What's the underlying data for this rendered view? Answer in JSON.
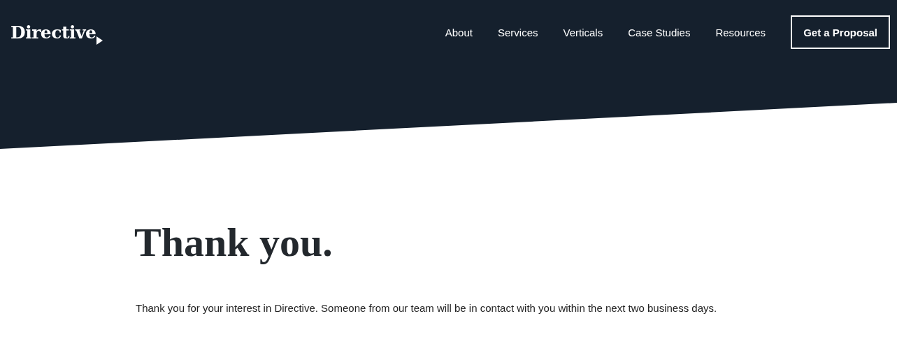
{
  "header": {
    "logo": "Directive",
    "nav": [
      {
        "label": "About"
      },
      {
        "label": "Services"
      },
      {
        "label": "Verticals"
      },
      {
        "label": "Case Studies"
      },
      {
        "label": "Resources"
      }
    ],
    "cta": "Get a Proposal"
  },
  "main": {
    "heading": "Thank you.",
    "message": "Thank you for your interest in Directive. Someone from our team will be in contact with you within the next two business days."
  }
}
